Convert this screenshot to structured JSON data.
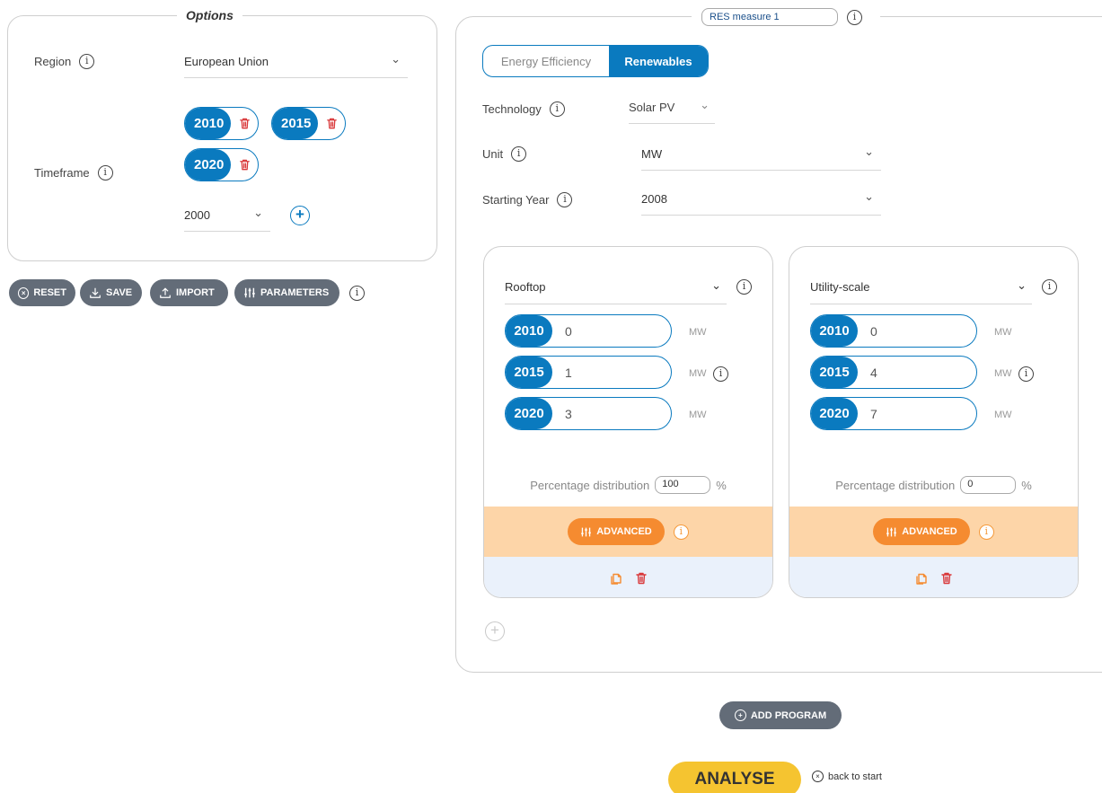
{
  "options": {
    "legend": "Options",
    "region_label": "Region",
    "region_value": "European Union",
    "timeframe_label": "Timeframe",
    "years": [
      "2010",
      "2015",
      "2020"
    ],
    "new_year_value": "2000"
  },
  "toolbar": {
    "reset": "RESET",
    "save": "SAVE",
    "import": "IMPORT",
    "parameters": "PARAMETERS"
  },
  "measure": {
    "name": "RES measure 1",
    "tabs": [
      {
        "label": "Energy Efficiency",
        "active": false
      },
      {
        "label": "Renewables",
        "active": true
      }
    ],
    "technology_label": "Technology",
    "technology_value": "Solar PV",
    "unit_label": "Unit",
    "unit_value": "MW",
    "starting_year_label": "Starting Year",
    "starting_year_value": "2008",
    "cards": [
      {
        "type": "Rooftop",
        "rows": [
          {
            "year": "2010",
            "value": "0",
            "unit": "MW"
          },
          {
            "year": "2015",
            "value": "1",
            "unit": "MW"
          },
          {
            "year": "2020",
            "value": "3",
            "unit": "MW"
          }
        ],
        "pct_label": "Percentage distribution",
        "pct_value": "100",
        "pct_unit": "%",
        "advanced": "ADVANCED"
      },
      {
        "type": "Utility-scale",
        "rows": [
          {
            "year": "2010",
            "value": "0",
            "unit": "MW"
          },
          {
            "year": "2015",
            "value": "4",
            "unit": "MW"
          },
          {
            "year": "2020",
            "value": "7",
            "unit": "MW"
          }
        ],
        "pct_label": "Percentage distribution",
        "pct_value": "0",
        "pct_unit": "%",
        "advanced": "ADVANCED"
      }
    ]
  },
  "actions": {
    "add_program": "ADD PROGRAM",
    "analyse": "ANALYSE",
    "back": "back to start"
  },
  "colors": {
    "primary_blue": "#0a7abf",
    "grey_button": "#636c78",
    "orange": "#f58b30",
    "orange_band": "#fdd5a8",
    "analyse_yellow": "#f5c430",
    "delete_red": "#d9383a"
  }
}
